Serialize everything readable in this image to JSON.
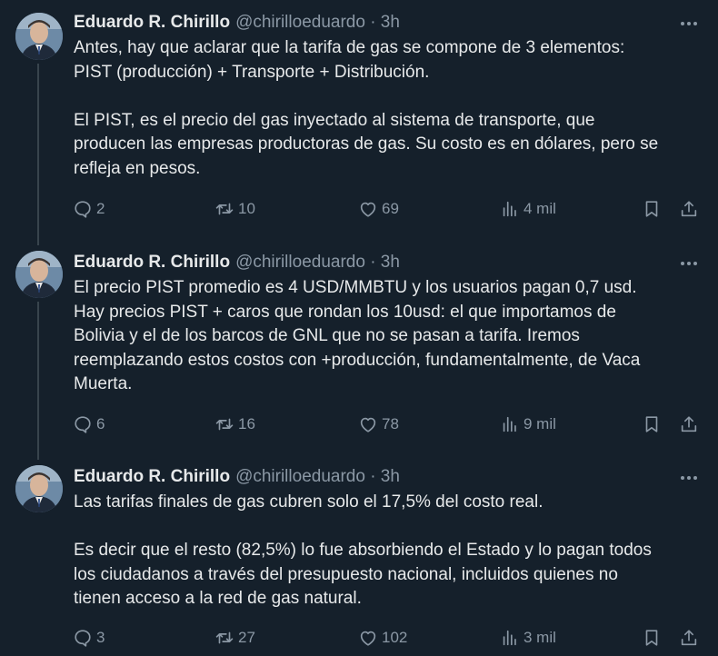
{
  "tweets": [
    {
      "name": "Eduardo R. Chirillo",
      "handle": "@chirilloeduardo · 3h",
      "text": "Antes, hay que aclarar que la tarifa de gas se compone de 3 elementos:\nPIST (producción) + Transporte + Distribución.\n\nEl PIST, es el precio del gas inyectado al sistema de transporte, que\nproducen las empresas productoras de gas. Su costo es en dólares, pero se\nrefleja en pesos.",
      "replies": "2",
      "retweets": "10",
      "likes": "69",
      "views": "4 mil"
    },
    {
      "name": "Eduardo R. Chirillo",
      "handle": "@chirilloeduardo · 3h",
      "text": "El precio PIST promedio es 4 USD/MMBTU y los usuarios pagan 0,7 usd.\nHay precios PIST + caros que rondan los 10usd: el que importamos de\nBolivia y el de los barcos de GNL que no se pasan a tarifa. Iremos\nreemplazando estos costos con +producción, fundamentalmente, de Vaca\nMuerta.",
      "replies": "6",
      "retweets": "16",
      "likes": "78",
      "views": "9 mil"
    },
    {
      "name": "Eduardo R. Chirillo",
      "handle": "@chirilloeduardo · 3h",
      "text": "Las tarifas finales de gas cubren solo el 17,5% del costo real.\n\nEs decir que el resto (82,5%) lo fue absorbiendo el Estado y lo pagan todos\nlos ciudadanos a través del presupuesto nacional, incluidos quienes no\ntienen acceso a la red de gas natural.",
      "replies": "3",
      "retweets": "27",
      "likes": "102",
      "views": "3 mil"
    }
  ],
  "icons": [
    "reply-icon",
    "retweet-icon",
    "like-icon",
    "views-icon",
    "bookmark-icon",
    "share-icon",
    "more-icon"
  ],
  "colors": {
    "background": "#15202b",
    "text": "#e7e9ea",
    "muted": "#8b98a5",
    "thread_line": "#38444d"
  }
}
